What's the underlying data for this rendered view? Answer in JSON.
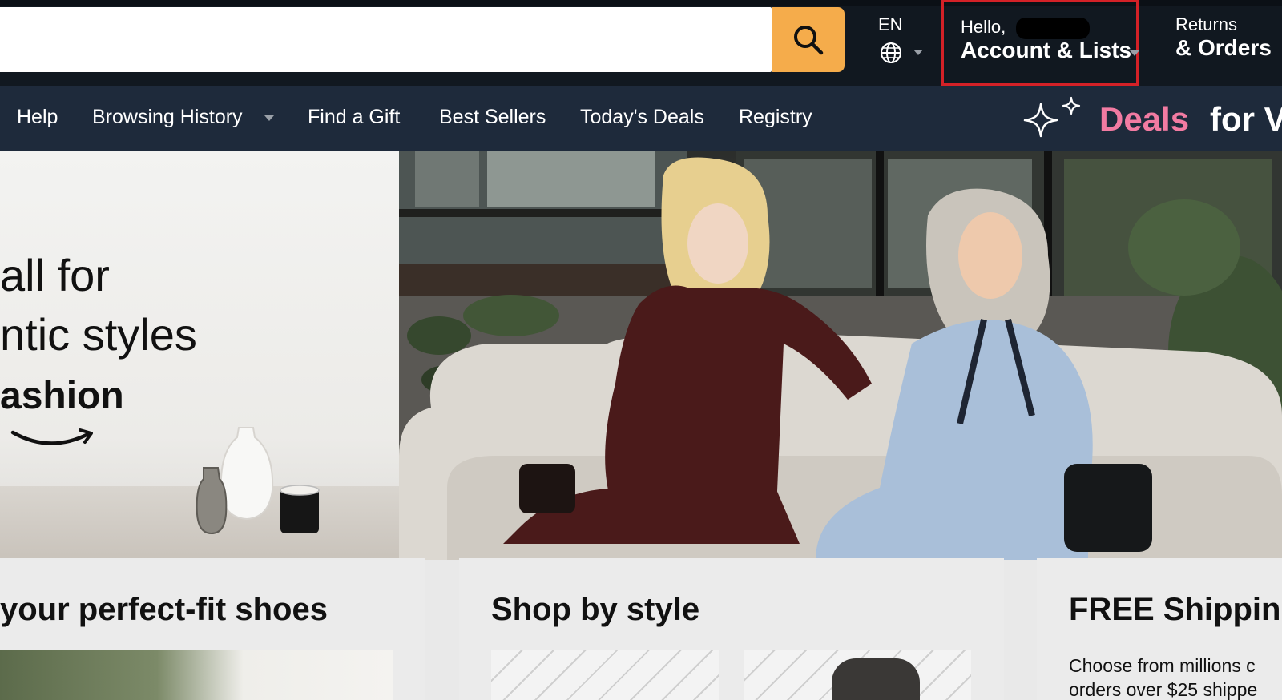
{
  "search": {
    "placeholder": ""
  },
  "language": {
    "code": "EN"
  },
  "account": {
    "greeting": "Hello,",
    "label": "Account & Lists"
  },
  "returns": {
    "line1": "Returns",
    "line2": "& Orders"
  },
  "nav": {
    "items": [
      {
        "label": "Help"
      },
      {
        "label": "Browsing History"
      },
      {
        "label": "Find a Gift"
      },
      {
        "label": "Best Sellers"
      },
      {
        "label": "Today's Deals"
      },
      {
        "label": "Registry"
      }
    ],
    "promo": {
      "highlight": "Deals",
      "rest": "for V"
    }
  },
  "hero": {
    "lines": [
      "all for",
      "ntic styles",
      "ashion"
    ]
  },
  "cards": [
    {
      "title": "your perfect-fit shoes"
    },
    {
      "title": "Shop by style"
    },
    {
      "title": "FREE Shippin",
      "text_line1": "Choose from millions c",
      "text_line2": "orders over $25 shippe"
    }
  ],
  "colors": {
    "topbar": "#111820",
    "navbar": "#1e2a3b",
    "search_button": "#f5ac4b",
    "highlight_border": "#d42127",
    "deals_pink": "#f27ba2"
  },
  "icons": [
    "search-icon",
    "globe-icon",
    "sparkle-icon",
    "amazon-smile-logo"
  ]
}
